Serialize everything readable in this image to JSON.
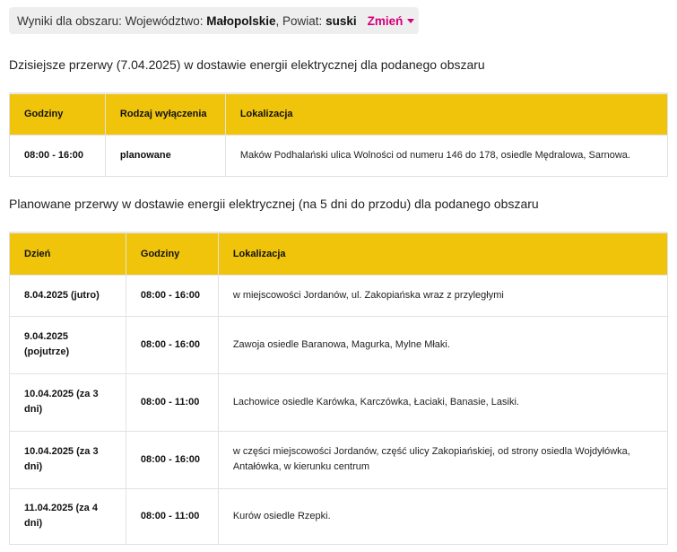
{
  "filter": {
    "prefix": "Wyniki dla obszaru: Województwo: ",
    "voivodeship": "Małopolskie",
    "mid": ", Powiat: ",
    "county": "suski",
    "change_label": "Zmień"
  },
  "today": {
    "heading": "Dzisiejsze przerwy (7.04.2025) w dostawie energii elektrycznej dla podanego obszaru",
    "headers": [
      "Godziny",
      "Rodzaj wyłączenia",
      "Lokalizacja"
    ],
    "rows": [
      [
        "08:00 - 16:00",
        "planowane",
        "Maków Podhalański ulica Wolności od numeru 146 do 178, osiedle Mędralowa, Sarnowa."
      ]
    ]
  },
  "planned": {
    "heading": "Planowane przerwy w dostawie energii elektrycznej (na 5 dni do przodu) dla podanego obszaru",
    "headers": [
      "Dzień",
      "Godziny",
      "Lokalizacja"
    ],
    "rows": [
      [
        "8.04.2025 (jutro)",
        "08:00 - 16:00",
        "w miejscowości Jordanów, ul. Zakopiańska wraz z przyległymi"
      ],
      [
        "9.04.2025 (pojutrze)",
        "08:00 - 16:00",
        "Zawoja osiedle Baranowa, Magurka, Mylne Młaki."
      ],
      [
        "10.04.2025 (za 3 dni)",
        "08:00 - 11:00",
        "Lachowice osiedle Karówka, Karczówka, Łaciaki, Banasie, Lasiki."
      ],
      [
        "10.04.2025 (za 3 dni)",
        "08:00 - 16:00",
        "w części miejscowości Jordanów, część ulicy Zakopiańskiej, od strony osiedla Wojdyłówka, Antałówka, w kierunku centrum"
      ],
      [
        "11.04.2025 (za 4 dni)",
        "08:00 - 11:00",
        "Kurów osiedle Rzepki."
      ]
    ]
  },
  "colors": {
    "header_bg": "#f0c40a",
    "accent": "#d4007a",
    "filter_bg": "#eeeeee"
  }
}
